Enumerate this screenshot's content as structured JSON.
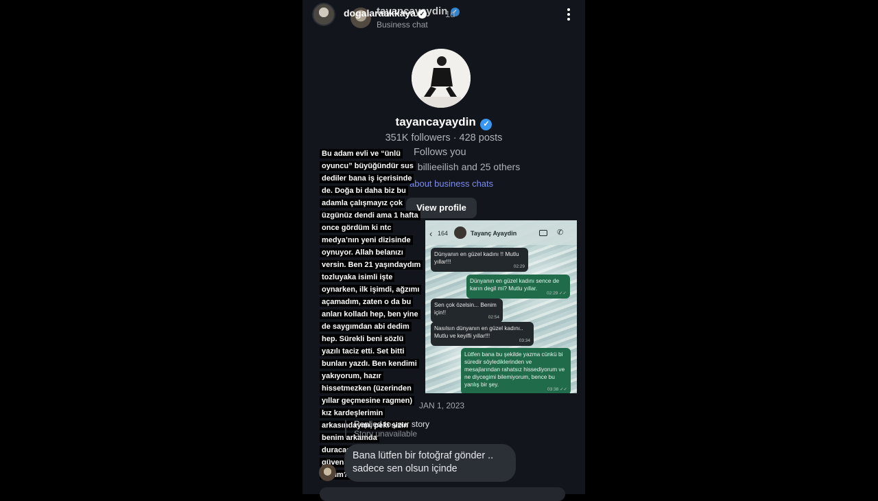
{
  "topbar": {
    "story_username": "dogalaraakkaya",
    "story_time": "1d",
    "chat_username": "tayancayaydin",
    "chat_subtitle": "Business chat"
  },
  "profile": {
    "username": "tayancayaydin",
    "stats": "351K followers · 428 posts",
    "follows_you": "Follows you",
    "mutuals": "ow billieeilish and 25 others",
    "about_link": "about business chats",
    "view_profile": "View profile"
  },
  "overlay_text": "Bu adam evli ve “ünlü oyuncu” büyüğündür sus dediler bana iş içerisinde de. Doğa bi daha biz bu adamla çalışmayız çok üzgünüz dendi ama 1 hafta once gördüm ki ntc medya’nın yeni dizisinde oynuyor. Allah belanızı versin. Ben 21 yaşındaydım tozluyaka isimli işte oynarken, ilk işimdi, ağzımı açamadım, zaten o da bu anları kolladı hep, ben yine de saygımdan abi dedim hep. Sürekli beni sözlü yazılı taciz etti. Set bitti bunları yazdı. Ben kendimi yakıyorum, hazır hissetmezken (üzerinden yıllar geçmesine ragmen) kız kardeşlerimin arkasındayım, peki sizin benim arkamda duracagınıza nasıl güvenicem? Yine yalnız mıyım?",
  "screenshot": {
    "back_count": "164",
    "contact": "Tayanç Ayaydin",
    "messages": [
      {
        "dir": "in",
        "text": "Dünyanın en güzel kadını !! Mutlu yıllar!!!",
        "time": "02:29"
      },
      {
        "dir": "out",
        "text": "Dünyanın en güzel kadını sence de karın degil mi? Mutlu yıllar.",
        "time": "02:29 ✓✓"
      },
      {
        "dir": "in",
        "text": "Sen çok özelsin... Benim için!!",
        "time": "02:54"
      },
      {
        "dir": "in",
        "text": "Nasılsın dünyanın en güzel kadını.. Mutlu ve keyifli yıllar!!!",
        "time": "03:34"
      },
      {
        "dir": "out",
        "text": "Lütfen bana bu şekilde yazma cünkü bi süredir söylediklerinden ve mesajlarından rahatsız hissediyorum ve ne diycegimi bilemiyorum, bence bu yanlış bir şey.",
        "time": "03:38 ✓✓"
      }
    ]
  },
  "thread": {
    "date": "JAN 1, 2023",
    "replied_to": "Replied to your story",
    "story_unavailable": "Story unavailable",
    "message": "Bana lütfen bir fotoğraf gönder  .. sadece sen olsun içinde"
  },
  "icons": {
    "verified": "verified-badge-icon",
    "menu": "more-vertical-icon",
    "back": "chevron-left-icon",
    "video": "video-call-icon",
    "call": "phone-icon"
  },
  "colors": {
    "background": "#12151b",
    "verified": "#3897f0",
    "link": "#7b8cf0",
    "outgoing_bubble": "#1f6b4a"
  }
}
